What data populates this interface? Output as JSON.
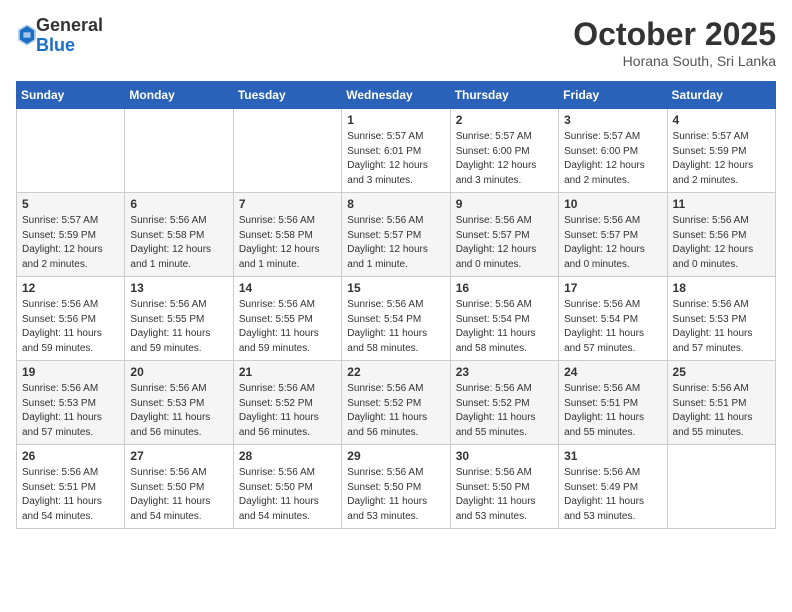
{
  "logo": {
    "general": "General",
    "blue": "Blue"
  },
  "header": {
    "month": "October 2025",
    "location": "Horana South, Sri Lanka"
  },
  "weekdays": [
    "Sunday",
    "Monday",
    "Tuesday",
    "Wednesday",
    "Thursday",
    "Friday",
    "Saturday"
  ],
  "weeks": [
    [
      {
        "day": "",
        "sunrise": "",
        "sunset": "",
        "daylight": ""
      },
      {
        "day": "",
        "sunrise": "",
        "sunset": "",
        "daylight": ""
      },
      {
        "day": "",
        "sunrise": "",
        "sunset": "",
        "daylight": ""
      },
      {
        "day": "1",
        "sunrise": "Sunrise: 5:57 AM",
        "sunset": "Sunset: 6:01 PM",
        "daylight": "Daylight: 12 hours and 3 minutes."
      },
      {
        "day": "2",
        "sunrise": "Sunrise: 5:57 AM",
        "sunset": "Sunset: 6:00 PM",
        "daylight": "Daylight: 12 hours and 3 minutes."
      },
      {
        "day": "3",
        "sunrise": "Sunrise: 5:57 AM",
        "sunset": "Sunset: 6:00 PM",
        "daylight": "Daylight: 12 hours and 2 minutes."
      },
      {
        "day": "4",
        "sunrise": "Sunrise: 5:57 AM",
        "sunset": "Sunset: 5:59 PM",
        "daylight": "Daylight: 12 hours and 2 minutes."
      }
    ],
    [
      {
        "day": "5",
        "sunrise": "Sunrise: 5:57 AM",
        "sunset": "Sunset: 5:59 PM",
        "daylight": "Daylight: 12 hours and 2 minutes."
      },
      {
        "day": "6",
        "sunrise": "Sunrise: 5:56 AM",
        "sunset": "Sunset: 5:58 PM",
        "daylight": "Daylight: 12 hours and 1 minute."
      },
      {
        "day": "7",
        "sunrise": "Sunrise: 5:56 AM",
        "sunset": "Sunset: 5:58 PM",
        "daylight": "Daylight: 12 hours and 1 minute."
      },
      {
        "day": "8",
        "sunrise": "Sunrise: 5:56 AM",
        "sunset": "Sunset: 5:57 PM",
        "daylight": "Daylight: 12 hours and 1 minute."
      },
      {
        "day": "9",
        "sunrise": "Sunrise: 5:56 AM",
        "sunset": "Sunset: 5:57 PM",
        "daylight": "Daylight: 12 hours and 0 minutes."
      },
      {
        "day": "10",
        "sunrise": "Sunrise: 5:56 AM",
        "sunset": "Sunset: 5:57 PM",
        "daylight": "Daylight: 12 hours and 0 minutes."
      },
      {
        "day": "11",
        "sunrise": "Sunrise: 5:56 AM",
        "sunset": "Sunset: 5:56 PM",
        "daylight": "Daylight: 12 hours and 0 minutes."
      }
    ],
    [
      {
        "day": "12",
        "sunrise": "Sunrise: 5:56 AM",
        "sunset": "Sunset: 5:56 PM",
        "daylight": "Daylight: 11 hours and 59 minutes."
      },
      {
        "day": "13",
        "sunrise": "Sunrise: 5:56 AM",
        "sunset": "Sunset: 5:55 PM",
        "daylight": "Daylight: 11 hours and 59 minutes."
      },
      {
        "day": "14",
        "sunrise": "Sunrise: 5:56 AM",
        "sunset": "Sunset: 5:55 PM",
        "daylight": "Daylight: 11 hours and 59 minutes."
      },
      {
        "day": "15",
        "sunrise": "Sunrise: 5:56 AM",
        "sunset": "Sunset: 5:54 PM",
        "daylight": "Daylight: 11 hours and 58 minutes."
      },
      {
        "day": "16",
        "sunrise": "Sunrise: 5:56 AM",
        "sunset": "Sunset: 5:54 PM",
        "daylight": "Daylight: 11 hours and 58 minutes."
      },
      {
        "day": "17",
        "sunrise": "Sunrise: 5:56 AM",
        "sunset": "Sunset: 5:54 PM",
        "daylight": "Daylight: 11 hours and 57 minutes."
      },
      {
        "day": "18",
        "sunrise": "Sunrise: 5:56 AM",
        "sunset": "Sunset: 5:53 PM",
        "daylight": "Daylight: 11 hours and 57 minutes."
      }
    ],
    [
      {
        "day": "19",
        "sunrise": "Sunrise: 5:56 AM",
        "sunset": "Sunset: 5:53 PM",
        "daylight": "Daylight: 11 hours and 57 minutes."
      },
      {
        "day": "20",
        "sunrise": "Sunrise: 5:56 AM",
        "sunset": "Sunset: 5:53 PM",
        "daylight": "Daylight: 11 hours and 56 minutes."
      },
      {
        "day": "21",
        "sunrise": "Sunrise: 5:56 AM",
        "sunset": "Sunset: 5:52 PM",
        "daylight": "Daylight: 11 hours and 56 minutes."
      },
      {
        "day": "22",
        "sunrise": "Sunrise: 5:56 AM",
        "sunset": "Sunset: 5:52 PM",
        "daylight": "Daylight: 11 hours and 56 minutes."
      },
      {
        "day": "23",
        "sunrise": "Sunrise: 5:56 AM",
        "sunset": "Sunset: 5:52 PM",
        "daylight": "Daylight: 11 hours and 55 minutes."
      },
      {
        "day": "24",
        "sunrise": "Sunrise: 5:56 AM",
        "sunset": "Sunset: 5:51 PM",
        "daylight": "Daylight: 11 hours and 55 minutes."
      },
      {
        "day": "25",
        "sunrise": "Sunrise: 5:56 AM",
        "sunset": "Sunset: 5:51 PM",
        "daylight": "Daylight: 11 hours and 55 minutes."
      }
    ],
    [
      {
        "day": "26",
        "sunrise": "Sunrise: 5:56 AM",
        "sunset": "Sunset: 5:51 PM",
        "daylight": "Daylight: 11 hours and 54 minutes."
      },
      {
        "day": "27",
        "sunrise": "Sunrise: 5:56 AM",
        "sunset": "Sunset: 5:50 PM",
        "daylight": "Daylight: 11 hours and 54 minutes."
      },
      {
        "day": "28",
        "sunrise": "Sunrise: 5:56 AM",
        "sunset": "Sunset: 5:50 PM",
        "daylight": "Daylight: 11 hours and 54 minutes."
      },
      {
        "day": "29",
        "sunrise": "Sunrise: 5:56 AM",
        "sunset": "Sunset: 5:50 PM",
        "daylight": "Daylight: 11 hours and 53 minutes."
      },
      {
        "day": "30",
        "sunrise": "Sunrise: 5:56 AM",
        "sunset": "Sunset: 5:50 PM",
        "daylight": "Daylight: 11 hours and 53 minutes."
      },
      {
        "day": "31",
        "sunrise": "Sunrise: 5:56 AM",
        "sunset": "Sunset: 5:49 PM",
        "daylight": "Daylight: 11 hours and 53 minutes."
      },
      {
        "day": "",
        "sunrise": "",
        "sunset": "",
        "daylight": ""
      }
    ]
  ]
}
